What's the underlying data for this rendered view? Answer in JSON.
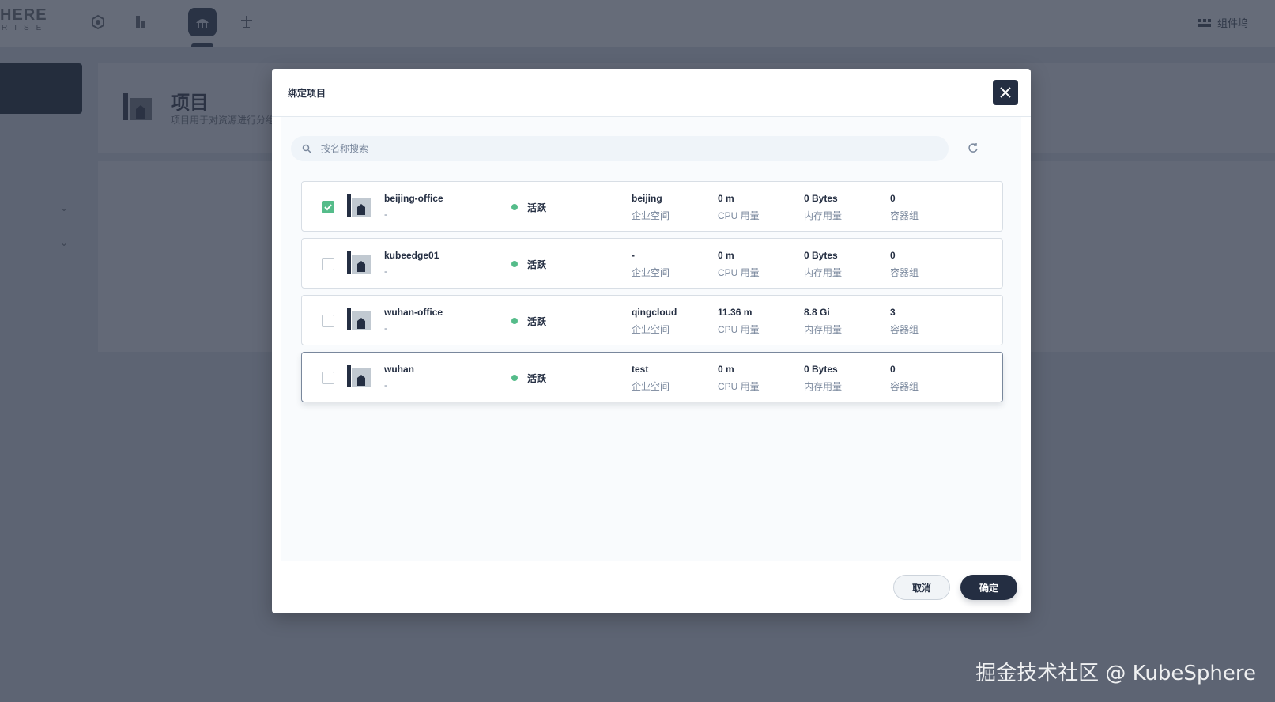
{
  "background": {
    "logo_top": "HERE",
    "logo_bottom": "RISE",
    "toolbox_label": "组件坞",
    "page_title": "项目",
    "page_desc": "项目用于对资源进行分组"
  },
  "modal": {
    "title": "绑定项目",
    "search_placeholder": "按名称搜索",
    "cancel_label": "取消",
    "confirm_label": "确定",
    "rows": [
      {
        "name": "beijing-office",
        "desc": "-",
        "status": "活跃",
        "workspace": "beijing",
        "workspace_label": "企业空间",
        "cpu": "0 m",
        "cpu_label": "CPU 用量",
        "memory": "0 Bytes",
        "memory_label": "内存用量",
        "pods": "0",
        "pods_label": "容器组",
        "checked": true
      },
      {
        "name": "kubeedge01",
        "desc": "-",
        "status": "活跃",
        "workspace": "-",
        "workspace_label": "企业空间",
        "cpu": "0 m",
        "cpu_label": "CPU 用量",
        "memory": "0 Bytes",
        "memory_label": "内存用量",
        "pods": "0",
        "pods_label": "容器组",
        "checked": false
      },
      {
        "name": "wuhan-office",
        "desc": "-",
        "status": "活跃",
        "workspace": "qingcloud",
        "workspace_label": "企业空间",
        "cpu": "11.36 m",
        "cpu_label": "CPU 用量",
        "memory": "8.8 Gi",
        "memory_label": "内存用量",
        "pods": "3",
        "pods_label": "容器组",
        "checked": false
      },
      {
        "name": "wuhan",
        "desc": "-",
        "status": "活跃",
        "workspace": "test",
        "workspace_label": "企业空间",
        "cpu": "0 m",
        "cpu_label": "CPU 用量",
        "memory": "0 Bytes",
        "memory_label": "内存用量",
        "pods": "0",
        "pods_label": "容器组",
        "checked": false
      }
    ]
  },
  "watermark": "掘金技术社区 @ KubeSphere",
  "colors": {
    "primary": "#242e42",
    "success": "#55bc8a",
    "muted": "#79879c"
  }
}
